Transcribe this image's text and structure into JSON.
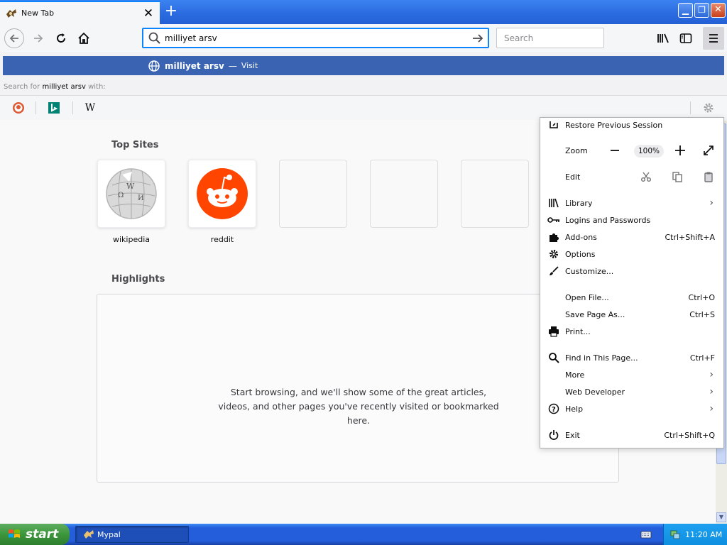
{
  "tab": {
    "title": "New Tab"
  },
  "toolbar": {
    "url_value": "milliyet arsv",
    "search_placeholder": "Search"
  },
  "urlpopup": {
    "suggestion_title": "milliyet arsv",
    "suggestion_sep": "—",
    "suggestion_action": "Visit",
    "search_for_prefix": "Search for",
    "search_for_query": "milliyet arsv",
    "search_for_suffix": "with:",
    "engines": [
      "duckduckgo-icon",
      "bing-icon",
      "wikipedia-icon"
    ],
    "wiki_letter": "W"
  },
  "content": {
    "top_sites_title": "Top Sites",
    "top_sites": [
      {
        "label": "wikipedia"
      },
      {
        "label": "reddit"
      },
      {
        "label": ""
      },
      {
        "label": ""
      },
      {
        "label": ""
      }
    ],
    "highlights_title": "Highlights",
    "highlights_message": "Start browsing, and we'll show some of the great articles, videos, and other pages you've recently visited or bookmarked here."
  },
  "menu": {
    "restore": "Restore Previous Session",
    "zoom_label": "Zoom",
    "zoom_value": "100%",
    "edit_label": "Edit",
    "items": [
      {
        "label": "Library",
        "shortcut": "",
        "chevron": "›"
      },
      {
        "label": "Logins and Passwords",
        "shortcut": ""
      },
      {
        "label": "Add-ons",
        "shortcut": "Ctrl+Shift+A"
      },
      {
        "label": "Options",
        "shortcut": ""
      },
      {
        "label": "Customize...",
        "shortcut": ""
      },
      {
        "label": "Open File...",
        "shortcut": "Ctrl+O"
      },
      {
        "label": "Save Page As...",
        "shortcut": "Ctrl+S"
      },
      {
        "label": "Print...",
        "shortcut": ""
      },
      {
        "label": "Find in This Page...",
        "shortcut": "Ctrl+F"
      },
      {
        "label": "More",
        "chevron": "›"
      },
      {
        "label": "Web Developer",
        "chevron": "›"
      },
      {
        "label": "Help",
        "chevron": "›"
      },
      {
        "label": "Exit",
        "shortcut": "Ctrl+Shift+Q"
      }
    ]
  },
  "taskbar": {
    "start": "start",
    "task": "Mypal",
    "clock": "11:20 AM"
  },
  "colors": {
    "accent": "#0a84ff",
    "suggest_bg": "#3a64b1",
    "taskbar": "#245edb",
    "start": "#3c963c"
  }
}
